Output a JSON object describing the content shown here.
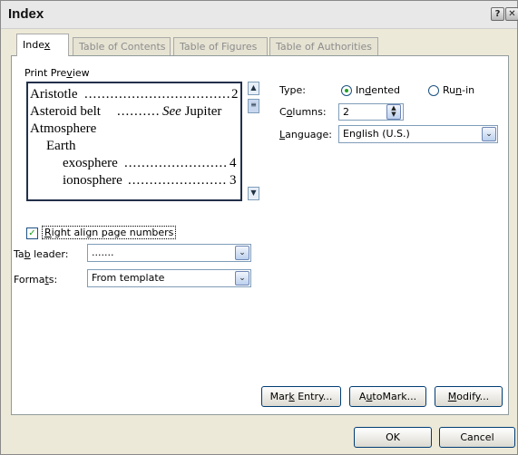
{
  "dialog": {
    "title": "Index",
    "help_glyph": "?",
    "close_glyph": "✕"
  },
  "tabs": [
    {
      "label": "Index",
      "underline": "x",
      "active": true
    },
    {
      "label": "Table of Contents",
      "active": false
    },
    {
      "label": "Table of Figures",
      "active": false
    },
    {
      "label": "Table of Authorities",
      "active": false
    }
  ],
  "preview": {
    "label": "Print Preview",
    "entries": [
      {
        "text": "Aristotle",
        "page": "2",
        "indent": 0
      },
      {
        "text": "Asteroid belt ",
        "see": "See",
        "target": " Jupiter",
        "indent": 0
      },
      {
        "text": "Atmosphere",
        "indent": 0
      },
      {
        "text": "Earth",
        "indent": 1
      },
      {
        "text": "exosphere",
        "page": "4",
        "indent": 2
      },
      {
        "text": "ionosphere",
        "page": "3",
        "indent": 2
      }
    ]
  },
  "type": {
    "label": "Type:",
    "options": [
      {
        "label": "Indented",
        "selected": true
      },
      {
        "label": "Run-in",
        "selected": false
      }
    ]
  },
  "columns": {
    "label": "Columns:",
    "value": "2"
  },
  "language": {
    "label": "Language:",
    "value": "English (U.S.)"
  },
  "right_align": {
    "label": "Right align page numbers",
    "checked": true
  },
  "tab_leader": {
    "label": "Tab leader:",
    "value": "......."
  },
  "formats": {
    "label": "Formats:",
    "value": "From template"
  },
  "buttons": {
    "mark_entry": "Mark Entry...",
    "automark": "AutoMark...",
    "modify": "Modify...",
    "ok": "OK",
    "cancel": "Cancel"
  },
  "colors": {
    "dialog_bg": "#ece9d8",
    "border_dark": "#22304a",
    "radio_dot": "#21a121"
  }
}
